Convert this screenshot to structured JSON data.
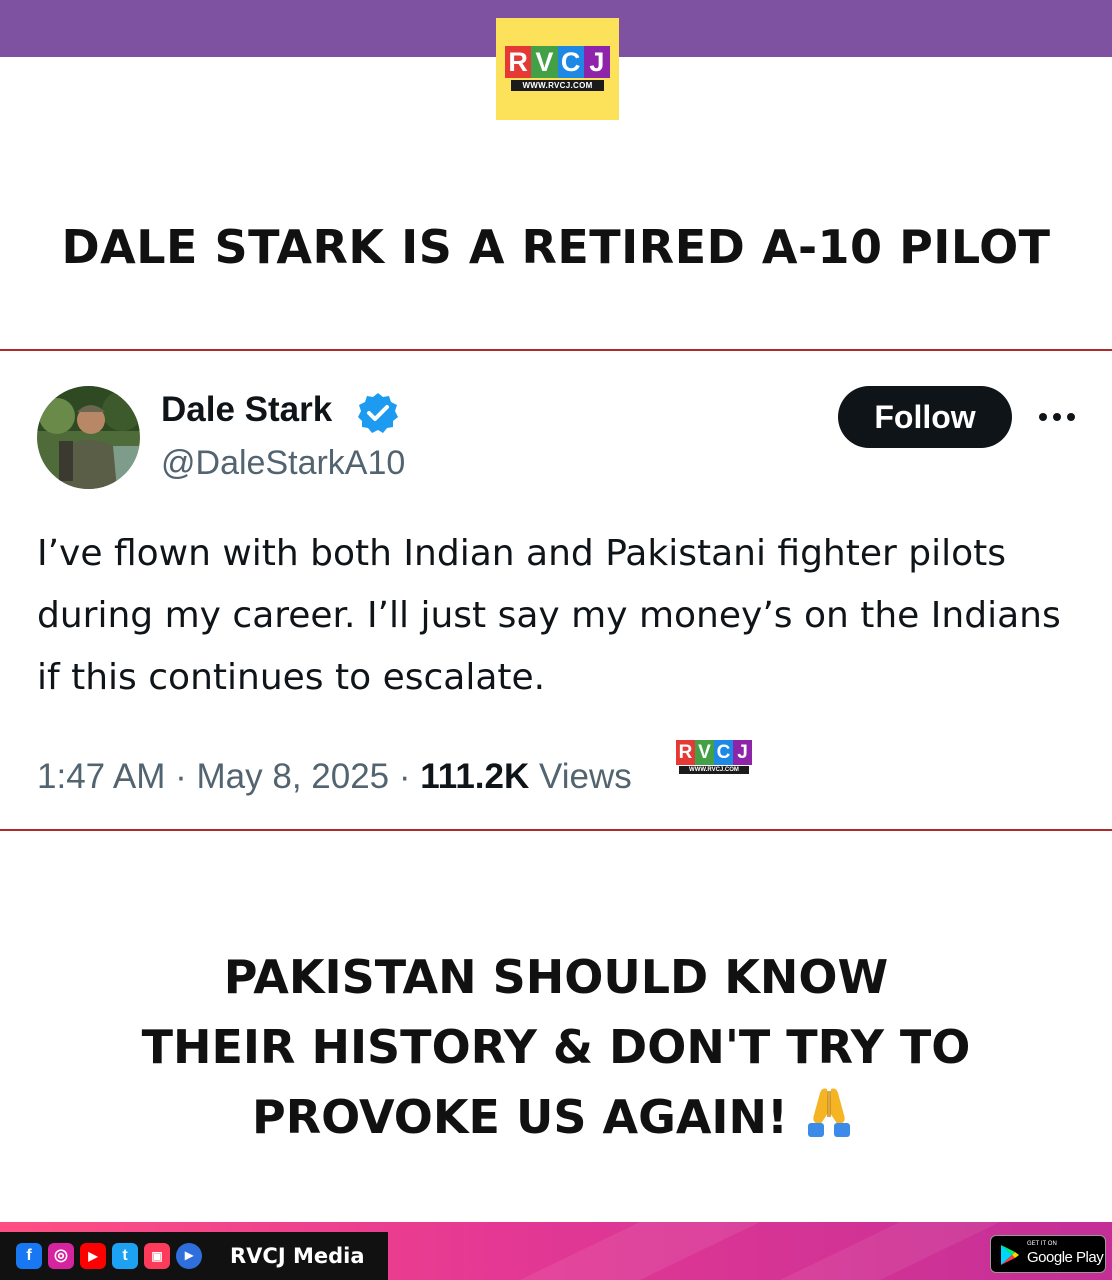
{
  "header": {
    "logo": {
      "letters": [
        "R",
        "V",
        "C",
        "J"
      ],
      "letter_colors": [
        "#e53935",
        "#43a047",
        "#1e88e5",
        "#8e24aa"
      ],
      "url": "WWW.RVCJ.COM"
    },
    "headline": "DALE STARK IS A RETIRED A-10 PILOT"
  },
  "tweet": {
    "author_name": "Dale Stark",
    "verified": true,
    "handle": "@DaleStarkA10",
    "follow_label": "Follow",
    "text": "I’ve flown with both Indian and Pakistani fighter pilots during my career. I’ll just say my money’s on the Indians if this continues to escalate.",
    "time": "1:47 AM",
    "separator": " · ",
    "date": "May 8, 2025",
    "views_count": "111.2K",
    "views_label": "Views",
    "watermark": {
      "letters": [
        "R",
        "V",
        "C",
        "J"
      ],
      "url": "WWW.RVCJ.COM"
    }
  },
  "closing": {
    "lines": [
      "PAKISTAN SHOULD KNOW",
      "THEIR HISTORY & DON'T TRY TO",
      "PROVOKE US AGAIN!"
    ],
    "emoji_icon": "folded-hands-icon"
  },
  "footer": {
    "social_icons": [
      {
        "name": "facebook-icon",
        "glyph": "f",
        "color": "#1877f2"
      },
      {
        "name": "instagram-icon",
        "glyph": "◎",
        "color": "#d6249f"
      },
      {
        "name": "youtube-icon",
        "glyph": "▶",
        "color": "#ff0000"
      },
      {
        "name": "twitter-icon",
        "glyph": "t",
        "color": "#1da1f2"
      },
      {
        "name": "youtube-shorts-icon",
        "glyph": "▣",
        "color": "#ff3b5c"
      },
      {
        "name": "play-icon",
        "glyph": "▸",
        "color": "#2f6fdd"
      }
    ],
    "brand_name": "RVCJ Media",
    "store": {
      "small_text": "GET IT ON",
      "name": "Google Play"
    }
  }
}
